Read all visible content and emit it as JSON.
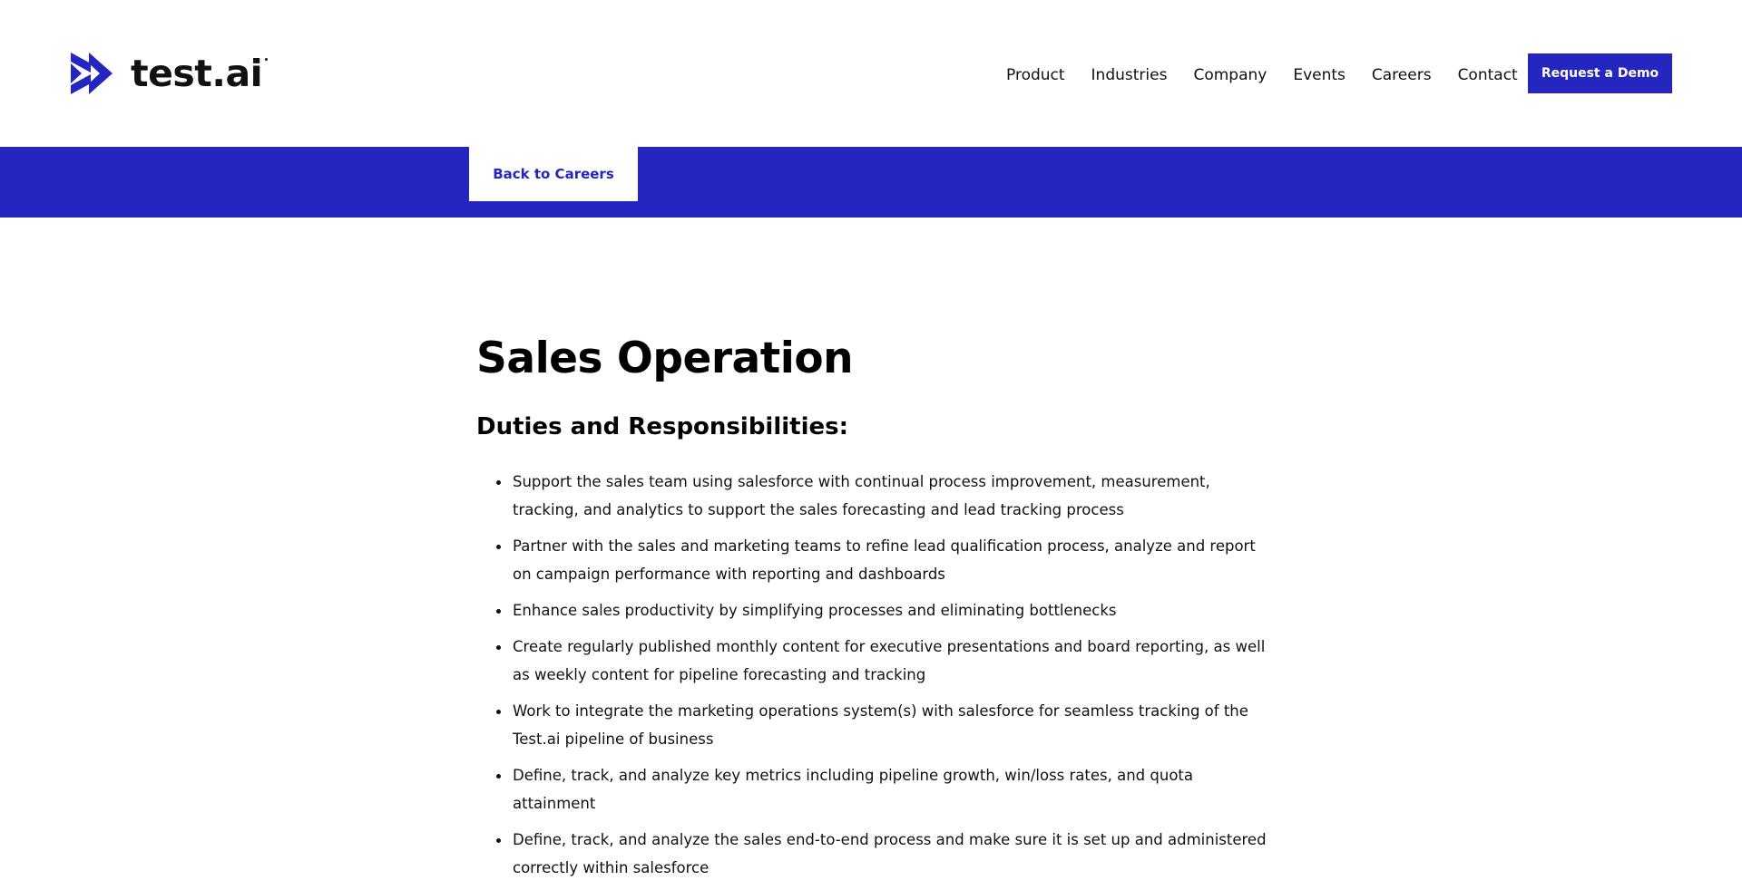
{
  "header": {
    "logo_text": "test.ai",
    "nav": [
      {
        "label": "Product"
      },
      {
        "label": "Industries"
      },
      {
        "label": "Company"
      },
      {
        "label": "Events"
      },
      {
        "label": "Careers"
      },
      {
        "label": "Contact"
      }
    ],
    "demo_button_label": "Request a Demo"
  },
  "band": {
    "back_label": "Back to Careers"
  },
  "job": {
    "title": "Sales Operation",
    "section_heading": "Duties and Responsibilities:",
    "duties": [
      "Support the sales team using salesforce with continual process improvement, measurement, tracking, and analytics to support the sales forecasting and lead tracking process",
      "Partner with the sales and marketing teams to refine lead qualification process, analyze and report on campaign performance with reporting and dashboards",
      "Enhance sales productivity by simplifying processes and eliminating bottlenecks",
      "Create regularly published monthly content for executive presentations and board reporting, as well as weekly content for pipeline forecasting and tracking",
      "Work to integrate the marketing operations system(s) with salesforce for seamless tracking of the Test.ai pipeline of business",
      "Define, track, and analyze key metrics including pipeline growth, win/loss rates, and quota attainment",
      "Define, track, and analyze the sales end-to-end process and make sure it is set up and administered correctly within salesforce"
    ]
  },
  "colors": {
    "brand_blue": "#2525c0",
    "text": "#111111",
    "background": "#ffffff"
  },
  "icons": {
    "logo_mark": "double-chevron-right-icon"
  }
}
